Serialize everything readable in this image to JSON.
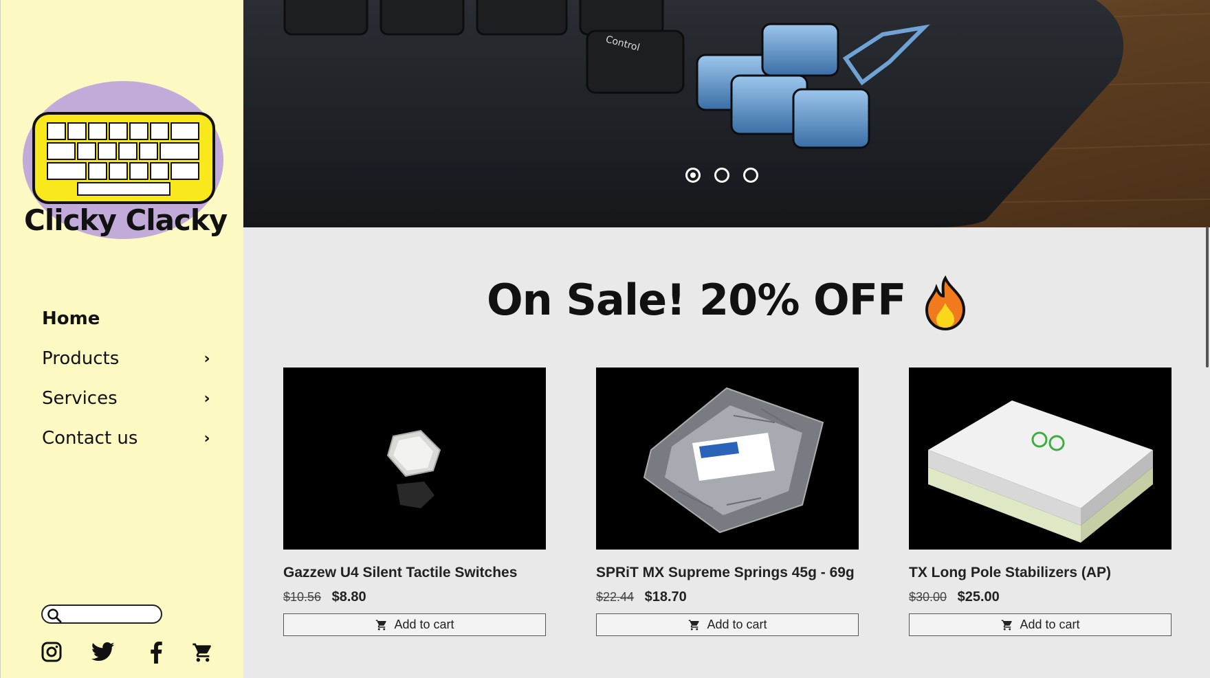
{
  "brand": {
    "name": "Clicky Clacky"
  },
  "nav": {
    "items": [
      {
        "label": "Home",
        "active": true,
        "has_submenu": false
      },
      {
        "label": "Products",
        "active": false,
        "has_submenu": true
      },
      {
        "label": "Services",
        "active": false,
        "has_submenu": true
      },
      {
        "label": "Contact us",
        "active": false,
        "has_submenu": true
      }
    ]
  },
  "search": {
    "placeholder": "",
    "value": ""
  },
  "social": [
    "instagram-icon",
    "twitter-icon",
    "facebook-icon",
    "cart-icon"
  ],
  "carousel": {
    "slides": 3,
    "active_index": 0
  },
  "sale": {
    "title": "On Sale! 20% OFF"
  },
  "products": [
    {
      "name": "Gazzew U4 Silent Tactile Switches",
      "old_price": "$10.56",
      "price": "$8.80",
      "button": "Add to cart"
    },
    {
      "name": "SPRiT MX Supreme Springs 45g - 69g",
      "old_price": "$22.44",
      "price": "$18.70",
      "button": "Add to cart"
    },
    {
      "name": "TX Long Pole Stabilizers (AP)",
      "old_price": "$30.00",
      "price": "$25.00",
      "button": "Add to cart"
    }
  ],
  "colors": {
    "sidebar_bg": "#fdf9c3",
    "logo_circle": "#c2abd8",
    "logo_keyboard": "#f8e81c",
    "page_bg": "#e9e9e9"
  }
}
